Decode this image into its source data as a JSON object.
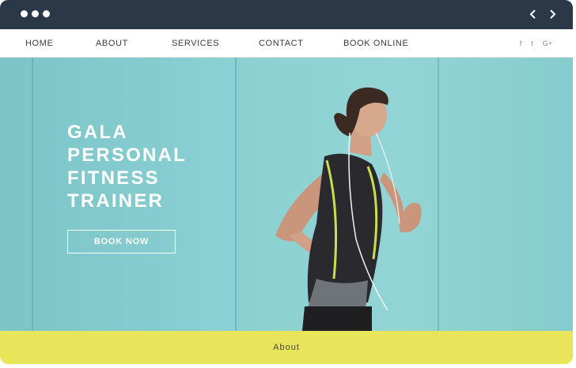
{
  "nav": {
    "items": [
      {
        "label": "HOME"
      },
      {
        "label": "ABOUT"
      },
      {
        "label": "SERVICES"
      },
      {
        "label": "CONTACT"
      },
      {
        "label": "BOOK ONLINE"
      }
    ],
    "social": {
      "facebook": "f",
      "twitter": "t",
      "google": "G+"
    }
  },
  "hero": {
    "title_lines": [
      "GALA",
      "PERSONAL",
      "FITNESS",
      "TRAINER"
    ],
    "cta_label": "BOOK NOW"
  },
  "footer": {
    "about_label": "About"
  },
  "colors": {
    "chrome": "#2b3847",
    "hero_bg": "#8bd0d2",
    "strip": "#e9e55b",
    "accent_lime": "#c8e04a"
  }
}
